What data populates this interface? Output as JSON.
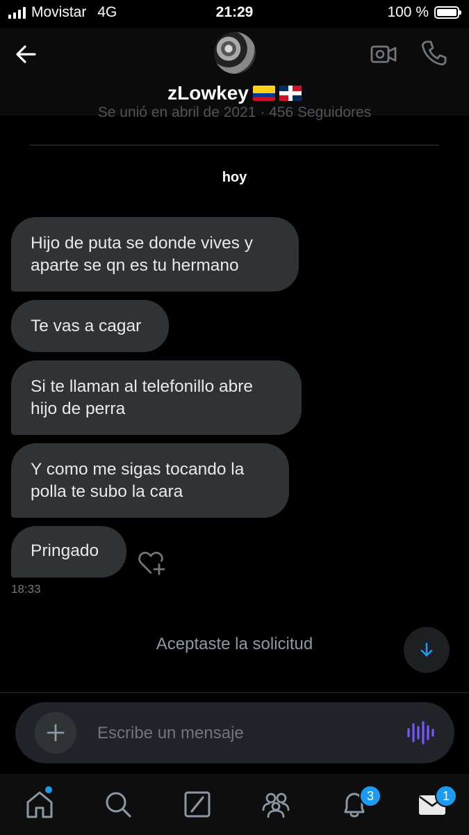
{
  "status_bar": {
    "carrier": "Movistar",
    "network": "4G",
    "time": "21:29",
    "battery": "100 %"
  },
  "header": {
    "name": "zLowkey",
    "flags": [
      "colombia-flag",
      "dominican-republic-flag"
    ],
    "icons": {
      "back": "arrow-left-icon",
      "video": "video-camera-icon",
      "phone": "phone-icon"
    }
  },
  "profile_info": {
    "joined": "Se unió en abril de 2021 · 456 Seguidores"
  },
  "conversation": {
    "day_label": "hoy",
    "messages": [
      "Hijo de puta se donde vives y aparte se qn es tu hermano",
      "Te vas a cagar",
      "Si te llaman al telefonillo abre hijo de perra",
      "Y como me sigas tocando la polla te subo la cara",
      "Pringado"
    ],
    "last_time": "18:33",
    "accepted_notice": "Aceptaste la solicitud"
  },
  "composer": {
    "placeholder": "Escribe un mensaje"
  },
  "nav": {
    "items": [
      "home-icon",
      "search-icon",
      "grok-icon",
      "communities-icon",
      "notifications-icon",
      "messages-icon"
    ],
    "notifications_badge": "3",
    "messages_badge": "1"
  },
  "colors": {
    "accent": "#1d9bf0",
    "bubble": "#2f3336",
    "background": "#000000",
    "voice": "#7856ff"
  }
}
